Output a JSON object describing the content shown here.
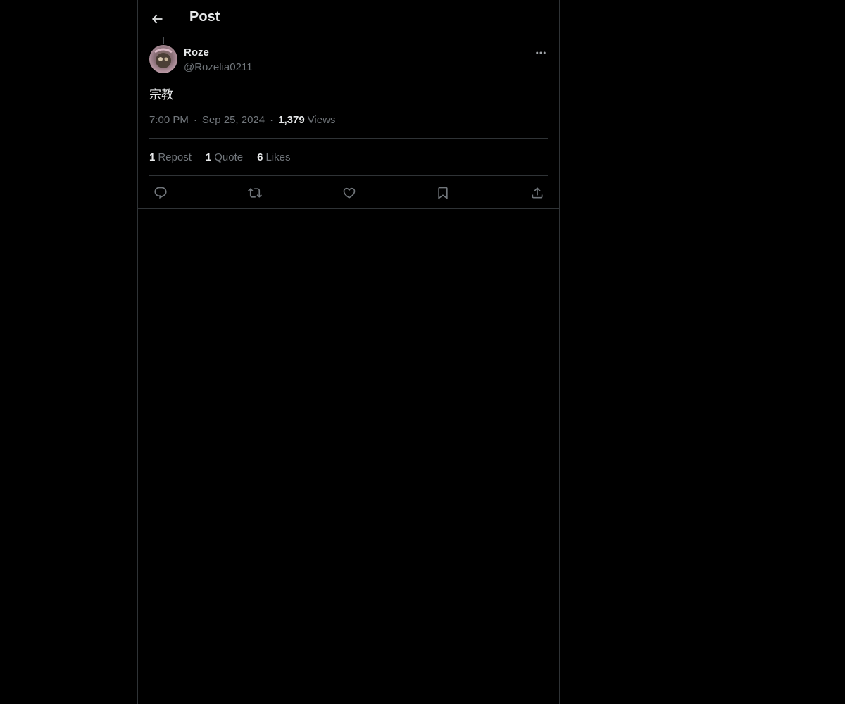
{
  "header": {
    "title": "Post"
  },
  "post": {
    "author": {
      "display_name": "Roze",
      "handle": "@Rozelia0211"
    },
    "text": "宗教",
    "time": "7:00 PM",
    "date": "Sep 25, 2024",
    "separator": "·",
    "views_count": "1,379",
    "views_label": "Views"
  },
  "stats": [
    {
      "count": "1",
      "label": "Repost"
    },
    {
      "count": "1",
      "label": "Quote"
    },
    {
      "count": "6",
      "label": "Likes"
    }
  ],
  "icons": {
    "back": "arrow-left-icon",
    "more": "more-horizontal-icon",
    "reply": "reply-icon",
    "repost": "repost-icon",
    "like": "heart-icon",
    "bookmark": "bookmark-icon",
    "share": "share-icon"
  },
  "colors": {
    "background": "#000000",
    "text": "#e7e9ea",
    "secondary": "#71767b",
    "border": "#2f3336"
  }
}
